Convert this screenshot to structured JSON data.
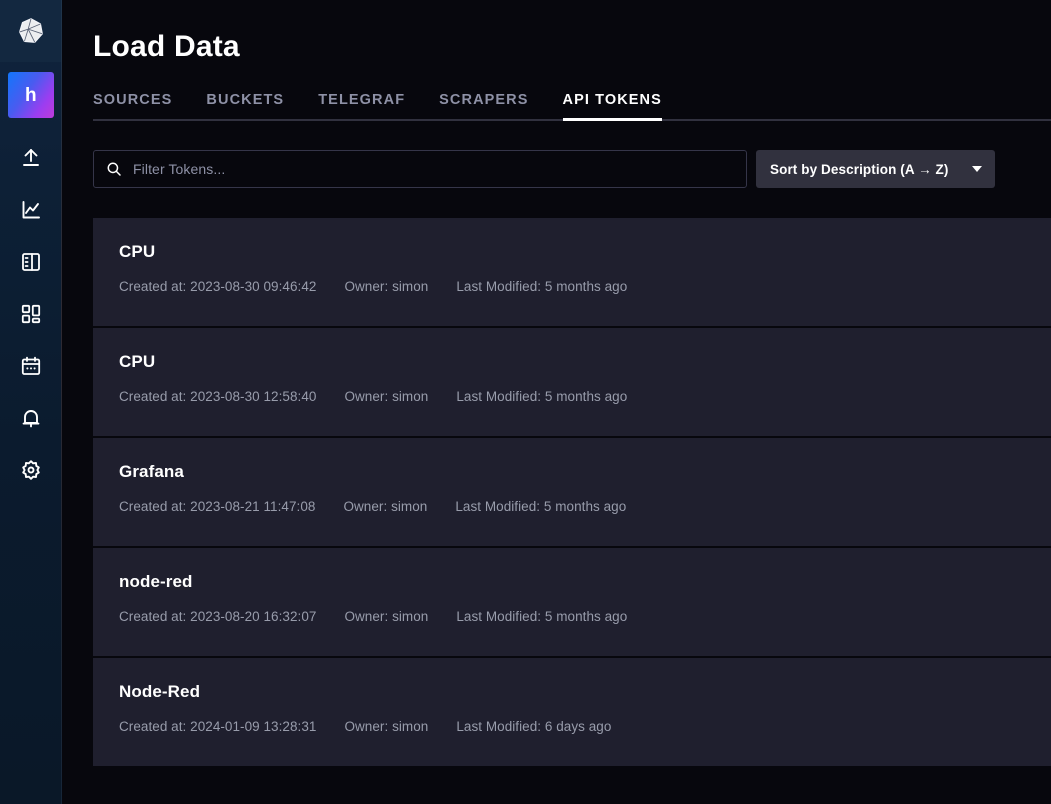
{
  "sidebar": {
    "logo": {
      "icon": "influxdb-logo-icon"
    },
    "avatar": {
      "label": "h"
    },
    "items": [
      {
        "icon": "upload-arrow-icon",
        "name": "load-data"
      },
      {
        "icon": "line-graph-icon",
        "name": "data-explorer"
      },
      {
        "icon": "notebook-icon",
        "name": "notebooks"
      },
      {
        "icon": "dashboards-grid-icon",
        "name": "dashboards"
      },
      {
        "icon": "calendar-tasks-icon",
        "name": "tasks"
      },
      {
        "icon": "bell-alert-icon",
        "name": "alerts"
      },
      {
        "icon": "gear-settings-icon",
        "name": "settings"
      }
    ]
  },
  "header": {
    "title": "Load Data"
  },
  "tabs": [
    {
      "label": "SOURCES",
      "active": false
    },
    {
      "label": "BUCKETS",
      "active": false
    },
    {
      "label": "TELEGRAF",
      "active": false
    },
    {
      "label": "SCRAPERS",
      "active": false
    },
    {
      "label": "API TOKENS",
      "active": true
    }
  ],
  "filter": {
    "search": {
      "value": "",
      "placeholder": "Filter Tokens...",
      "icon": "search-icon"
    },
    "sort": {
      "label": "Sort by Description (A → Z)",
      "icon": "chevron-down-icon"
    }
  },
  "tokens": [
    {
      "name": "CPU",
      "created": "Created at: 2023-08-30 09:46:42",
      "owner": "Owner: simon",
      "modified": "Last Modified: 5 months ago"
    },
    {
      "name": "CPU",
      "created": "Created at: 2023-08-30 12:58:40",
      "owner": "Owner: simon",
      "modified": "Last Modified: 5 months ago"
    },
    {
      "name": "Grafana",
      "created": "Created at: 2023-08-21 11:47:08",
      "owner": "Owner: simon",
      "modified": "Last Modified: 5 months ago"
    },
    {
      "name": "node-red",
      "created": "Created at: 2023-08-20 16:32:07",
      "owner": "Owner: simon",
      "modified": "Last Modified: 5 months ago"
    },
    {
      "name": "Node-Red",
      "created": "Created at: 2024-01-09 13:28:31",
      "owner": "Owner: simon",
      "modified": "Last Modified: 6 days ago"
    }
  ],
  "colors": {
    "page_bg": "#07070d",
    "row_bg": "#1f1f2e",
    "sidebar_top": "#10243e",
    "accent_white": "#ffffff",
    "muted_text": "#8e91a6",
    "select_bg": "#31313e"
  }
}
